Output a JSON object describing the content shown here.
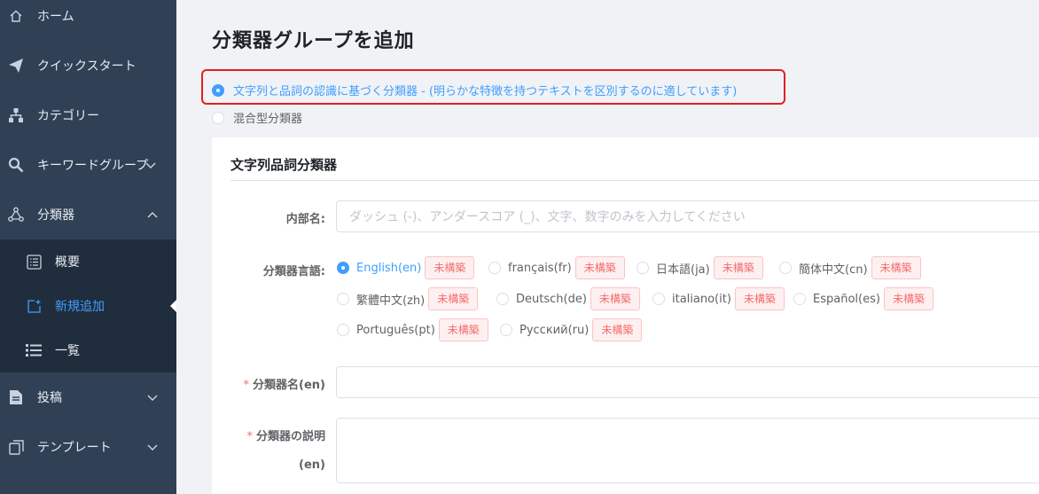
{
  "sidebar": {
    "items": [
      {
        "label": "ホーム",
        "icon": "home-icon"
      },
      {
        "label": "クイックスタート",
        "icon": "paper-plane-icon"
      },
      {
        "label": "カテゴリー",
        "icon": "sitemap-icon"
      },
      {
        "label": "キーワードグループ",
        "icon": "key-search-icon"
      },
      {
        "label": "分類器",
        "icon": "nodes-icon"
      },
      {
        "label": "投稿",
        "icon": "document-icon"
      },
      {
        "label": "テンプレート",
        "icon": "copy-icon"
      }
    ],
    "submenu": [
      {
        "label": "概要",
        "icon": "list-box-icon"
      },
      {
        "label": "新規追加",
        "icon": "add-square-icon"
      },
      {
        "label": "一覧",
        "icon": "list-icon"
      }
    ],
    "active_color": "#409eff"
  },
  "page": {
    "title": "分類器グループを追加",
    "classifier_types": [
      {
        "label": "文字列と品詞の認識に基づく分類器 - (明らかな特徴を持つテキストを区別するのに適しています)",
        "selected": true
      },
      {
        "label": "混合型分類器",
        "selected": false
      }
    ]
  },
  "form": {
    "section_title": "文字列品詞分類器",
    "internal_name_label": "内部名:",
    "internal_name_placeholder": "ダッシュ (-)、アンダースコア (_)、文字、数字のみを入力してください",
    "languages_label": "分類器言語:",
    "languages": [
      {
        "name": "English(en)",
        "status": "未構築",
        "selected": true
      },
      {
        "name": "français(fr)",
        "status": "未構築",
        "selected": false
      },
      {
        "name": "日本語(ja)",
        "status": "未構築",
        "selected": false
      },
      {
        "name": "簡体中文(cn)",
        "status": "未構築",
        "selected": false
      },
      {
        "name": "繁體中文(zh)",
        "status": "未構築",
        "selected": false
      },
      {
        "name": "Deutsch(de)",
        "status": "未構築",
        "selected": false
      },
      {
        "name": "italiano(it)",
        "status": "未構築",
        "selected": false
      },
      {
        "name": "Español(es)",
        "status": "未構築",
        "selected": false
      },
      {
        "name": "Português(pt)",
        "status": "未構築",
        "selected": false
      },
      {
        "name": "Русский(ru)",
        "status": "未構築",
        "selected": false
      }
    ],
    "classifier_name_label": "分類器名(en)",
    "description_label_line1": "分類器の説明",
    "description_label_line2": "(en)",
    "required_mark": "*"
  }
}
